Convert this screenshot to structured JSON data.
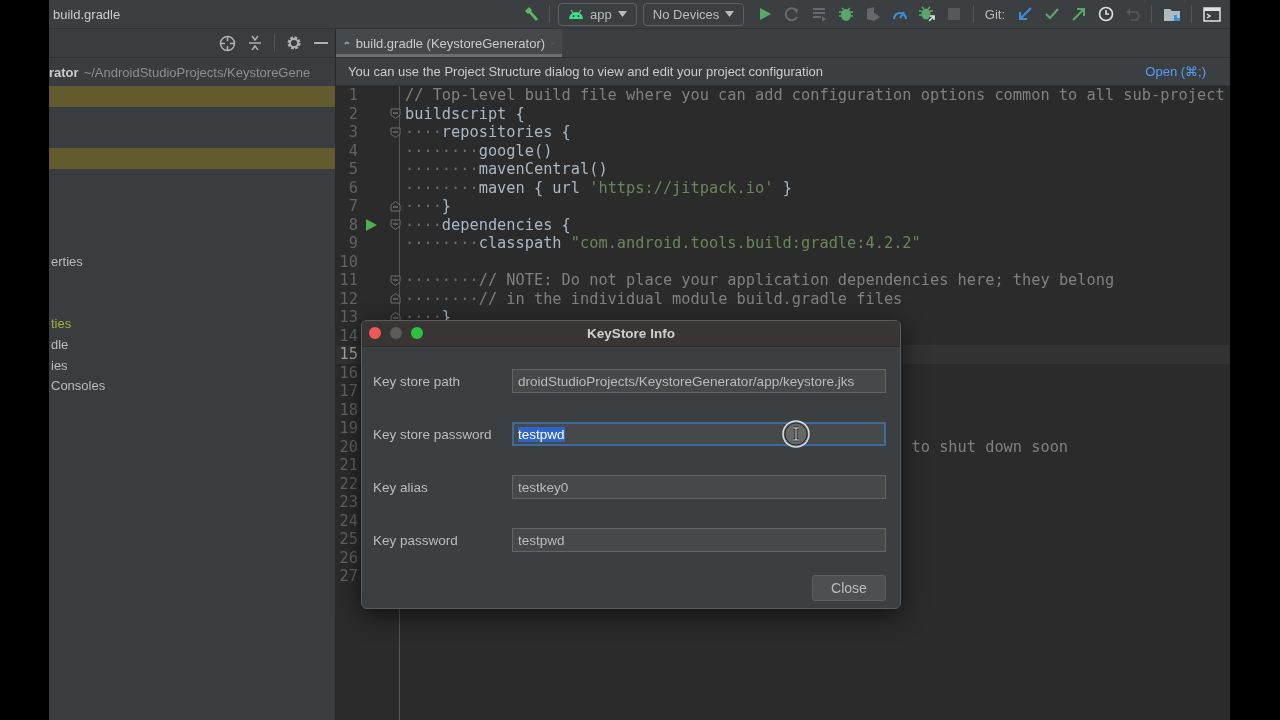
{
  "window": {
    "title": "build.gradle"
  },
  "toolbar": [
    [
      {
        "kind": "hammer",
        "disabled": false
      }
    ],
    [
      {
        "kind": "target-dropdown",
        "label": "app",
        "disabled": false
      },
      {
        "kind": "device-dropdown",
        "label": "No Devices",
        "disabled": false
      },
      {
        "kind": "run",
        "disabled": false
      },
      {
        "kind": "rerun",
        "disabled": true
      },
      {
        "kind": "list",
        "disabled": true
      },
      {
        "kind": "debug",
        "disabled": false
      },
      {
        "kind": "attach",
        "disabled": true
      },
      {
        "kind": "profile",
        "disabled": false
      },
      {
        "kind": "debug-attach",
        "disabled": false
      },
      {
        "kind": "stop",
        "disabled": true
      }
    ],
    [
      {
        "kind": "label",
        "label": "Git:",
        "disabled": false
      },
      {
        "kind": "update",
        "disabled": false
      },
      {
        "kind": "commit",
        "disabled": false
      },
      {
        "kind": "push",
        "disabled": false
      },
      {
        "kind": "history",
        "disabled": false
      },
      {
        "kind": "rollback",
        "disabled": true
      }
    ],
    [
      {
        "kind": "project-structure",
        "disabled": false
      }
    ],
    [
      {
        "kind": "terminal",
        "disabled": false
      }
    ]
  ],
  "project": {
    "name": "rator",
    "location": "~/AndroidStudioProjects/KeystoreGene",
    "tree": [
      {
        "highlighted": true
      },
      {
        "highlighted": false
      },
      {
        "highlighted": false
      },
      {
        "highlighted": true
      },
      {
        "highlighted": false
      },
      {
        "highlighted": false
      },
      {
        "highlighted": false
      },
      {
        "highlighted": false
      },
      {
        "highlighted": false,
        "label": "erties",
        "color": "#bbbbbb"
      },
      {
        "highlighted": false
      },
      {
        "highlighted": false
      },
      {
        "highlighted": false,
        "label": "ties",
        "color": "#a7ad3f"
      },
      {
        "highlighted": false,
        "label": "dle",
        "color": "#bbbbbb"
      },
      {
        "highlighted": false,
        "label": "ies",
        "color": "#bbbbbb"
      },
      {
        "highlighted": false,
        "label": "Consoles",
        "color": "#bbbbbb"
      }
    ]
  },
  "editor": {
    "tab": {
      "label": "build.gradle (KeystoreGenerator)",
      "selected": true
    },
    "banner": {
      "text": "You can use the Project Structure dialog to view and edit your project configuration",
      "link": "Open (⌘;)"
    },
    "lines": [
      {
        "number": "1",
        "fold_start": false,
        "fold_end": false,
        "run": false,
        "current": false,
        "segments": [
          {
            "kind": "comment",
            "text": "// Top-level build file where you can add configuration options common to all sub-project"
          }
        ]
      },
      {
        "number": "2",
        "fold_start": true,
        "fold_end": false,
        "run": false,
        "current": false,
        "segments": [
          {
            "kind": "plain",
            "text": "buildscript {"
          }
        ]
      },
      {
        "number": "3",
        "fold_start": true,
        "fold_end": false,
        "run": false,
        "current": false,
        "segments": [
          {
            "kind": "whitespace",
            "text": "····"
          },
          {
            "kind": "plain",
            "text": "repositories {"
          }
        ]
      },
      {
        "number": "4",
        "fold_start": false,
        "fold_end": false,
        "run": false,
        "current": false,
        "segments": [
          {
            "kind": "whitespace",
            "text": "········"
          },
          {
            "kind": "plain",
            "text": "google()"
          }
        ]
      },
      {
        "number": "5",
        "fold_start": false,
        "fold_end": false,
        "run": false,
        "current": false,
        "segments": [
          {
            "kind": "whitespace",
            "text": "········"
          },
          {
            "kind": "plain",
            "text": "mavenCentral()"
          }
        ]
      },
      {
        "number": "6",
        "fold_start": false,
        "fold_end": false,
        "run": false,
        "current": false,
        "segments": [
          {
            "kind": "whitespace",
            "text": "········"
          },
          {
            "kind": "plain",
            "text": "maven { url"
          },
          {
            "kind": "string",
            "text": "'https://jitpack.io'"
          },
          {
            "kind": "plain",
            "text": "}"
          }
        ]
      },
      {
        "number": "7",
        "fold_start": false,
        "fold_end": true,
        "run": false,
        "current": false,
        "segments": [
          {
            "kind": "whitespace",
            "text": "····"
          },
          {
            "kind": "plain",
            "text": "}"
          }
        ]
      },
      {
        "number": "8",
        "fold_start": true,
        "fold_end": false,
        "run": true,
        "current": false,
        "segments": [
          {
            "kind": "whitespace",
            "text": "····"
          },
          {
            "kind": "plain",
            "text": "dependencies {"
          }
        ]
      },
      {
        "number": "9",
        "fold_start": false,
        "fold_end": false,
        "run": false,
        "current": false,
        "segments": [
          {
            "kind": "whitespace",
            "text": "········"
          },
          {
            "kind": "plain",
            "text": "classpath"
          },
          {
            "kind": "string",
            "text": "\"com.android.tools.build:gradle:4.2.2\""
          }
        ]
      },
      {
        "number": "10",
        "fold_start": false,
        "fold_end": false,
        "run": false,
        "current": false
      },
      {
        "number": "11",
        "fold_start": true,
        "fold_end": false,
        "run": false,
        "current": false,
        "segments": [
          {
            "kind": "whitespace",
            "text": "········"
          },
          {
            "kind": "comment",
            "text": "// NOTE: Do not place your application dependencies here; they belong"
          }
        ]
      },
      {
        "number": "12",
        "fold_start": false,
        "fold_end": true,
        "run": false,
        "current": false,
        "segments": [
          {
            "kind": "whitespace",
            "text": "········"
          },
          {
            "kind": "comment",
            "text": "// in the individual module build.gradle files"
          }
        ]
      },
      {
        "number": "13",
        "fold_start": false,
        "fold_end": true,
        "run": false,
        "current": false,
        "segments": [
          {
            "kind": "whitespace",
            "text": "····"
          },
          {
            "kind": "plain",
            "text": "}"
          }
        ]
      },
      {
        "number": "14",
        "fold_start": false,
        "fold_end": false,
        "run": false,
        "current": false
      },
      {
        "number": "15",
        "fold_start": false,
        "fold_end": false,
        "run": false,
        "current": true
      },
      {
        "number": "16",
        "fold_start": false,
        "fold_end": false,
        "run": false,
        "current": false
      },
      {
        "number": "17",
        "fold_start": false,
        "fold_end": false,
        "run": false,
        "current": false
      },
      {
        "number": "18",
        "fold_start": false,
        "fold_end": false,
        "run": false,
        "current": false
      },
      {
        "number": "19",
        "fold_start": false,
        "fold_end": false,
        "run": false,
        "current": false
      },
      {
        "number": "20",
        "fold_start": false,
        "fold_end": false,
        "run": false,
        "current": false,
        "segments": [
          {
            "kind": "tail",
            "text": "to shut down soon"
          }
        ]
      },
      {
        "number": "21",
        "fold_start": false,
        "fold_end": false,
        "run": false,
        "current": false
      },
      {
        "number": "22",
        "fold_start": false,
        "fold_end": false,
        "run": false,
        "current": false
      },
      {
        "number": "23",
        "fold_start": false,
        "fold_end": false,
        "run": false,
        "current": false
      },
      {
        "number": "24",
        "fold_start": false,
        "fold_end": false,
        "run": false,
        "current": false
      },
      {
        "number": "25",
        "fold_start": false,
        "fold_end": false,
        "run": false,
        "current": false
      },
      {
        "number": "26",
        "fold_start": false,
        "fold_end": false,
        "run": false,
        "current": false
      },
      {
        "number": "27",
        "fold_start": false,
        "fold_end": false,
        "run": false,
        "current": false
      }
    ]
  },
  "dialog": {
    "title": "KeyStore Info",
    "fields": [
      {
        "label": "Key store path",
        "value": "droidStudioProjects/KeystoreGenerator/app/keystore.jks",
        "focused": false,
        "text_selected": false
      },
      {
        "label": "Key store password",
        "value": "testpwd",
        "focused": true,
        "text_selected": true
      },
      {
        "label": "Key alias",
        "value": "testkey0",
        "focused": false,
        "text_selected": false
      },
      {
        "label": "Key password",
        "value": "testpwd",
        "focused": false,
        "text_selected": false
      }
    ],
    "button": "Close"
  }
}
